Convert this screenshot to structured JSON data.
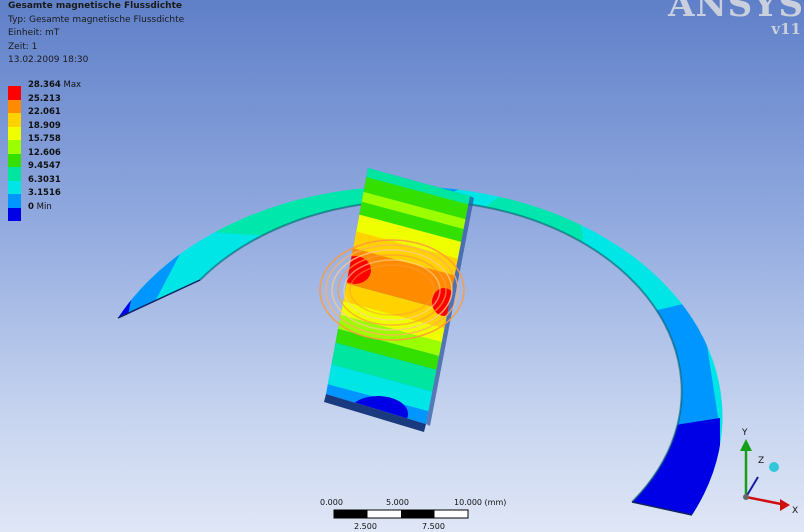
{
  "info": {
    "title": "Gesamte magnetische Flussdichte",
    "type": "Typ: Gesamte magnetische Flussdichte",
    "unit": "Einheit: mT",
    "time": "Zeit: 1",
    "date": "13.02.2009 18:30"
  },
  "legend": [
    {
      "label": "28.364",
      "suffix": "Max",
      "color": "#ff0000"
    },
    {
      "label": "25.213",
      "suffix": "",
      "color": "#ff8c00"
    },
    {
      "label": "22.061",
      "suffix": "",
      "color": "#ffd200"
    },
    {
      "label": "18.909",
      "suffix": "",
      "color": "#f0ff00"
    },
    {
      "label": "15.758",
      "suffix": "",
      "color": "#9cff00"
    },
    {
      "label": "12.606",
      "suffix": "",
      "color": "#33e000"
    },
    {
      "label": "9.4547",
      "suffix": "",
      "color": "#00e6a0"
    },
    {
      "label": "6.3031",
      "suffix": "",
      "color": "#00e6e6"
    },
    {
      "label": "3.1516",
      "suffix": "",
      "color": "#0096ff"
    },
    {
      "label": "0",
      "suffix": "Min",
      "color": "#0000e6"
    }
  ],
  "logo": {
    "brand": "ANSYS",
    "version": "v11"
  },
  "scale_bar": {
    "top_labels": [
      "0.000",
      "5.000",
      "10.000 (mm)"
    ],
    "bottom_labels": [
      "2.500",
      "7.500"
    ]
  },
  "triad": {
    "y": "Y",
    "z": "Z",
    "x": "X"
  }
}
